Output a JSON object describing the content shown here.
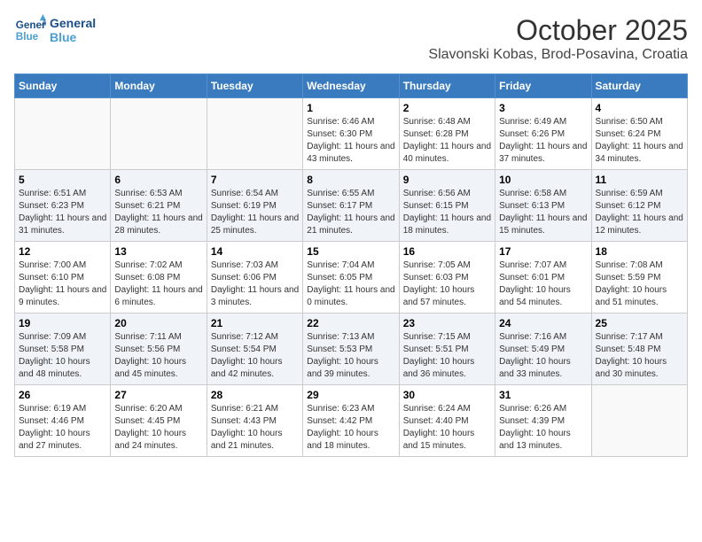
{
  "header": {
    "logo": {
      "line1": "General",
      "line2": "Blue"
    },
    "title": "October 2025",
    "subtitle": "Slavonski Kobas, Brod-Posavina, Croatia"
  },
  "days_of_week": [
    "Sunday",
    "Monday",
    "Tuesday",
    "Wednesday",
    "Thursday",
    "Friday",
    "Saturday"
  ],
  "weeks": [
    [
      {
        "day": "",
        "info": ""
      },
      {
        "day": "",
        "info": ""
      },
      {
        "day": "",
        "info": ""
      },
      {
        "day": "1",
        "info": "Sunrise: 6:46 AM\nSunset: 6:30 PM\nDaylight: 11 hours and 43 minutes."
      },
      {
        "day": "2",
        "info": "Sunrise: 6:48 AM\nSunset: 6:28 PM\nDaylight: 11 hours and 40 minutes."
      },
      {
        "day": "3",
        "info": "Sunrise: 6:49 AM\nSunset: 6:26 PM\nDaylight: 11 hours and 37 minutes."
      },
      {
        "day": "4",
        "info": "Sunrise: 6:50 AM\nSunset: 6:24 PM\nDaylight: 11 hours and 34 minutes."
      }
    ],
    [
      {
        "day": "5",
        "info": "Sunrise: 6:51 AM\nSunset: 6:23 PM\nDaylight: 11 hours and 31 minutes."
      },
      {
        "day": "6",
        "info": "Sunrise: 6:53 AM\nSunset: 6:21 PM\nDaylight: 11 hours and 28 minutes."
      },
      {
        "day": "7",
        "info": "Sunrise: 6:54 AM\nSunset: 6:19 PM\nDaylight: 11 hours and 25 minutes."
      },
      {
        "day": "8",
        "info": "Sunrise: 6:55 AM\nSunset: 6:17 PM\nDaylight: 11 hours and 21 minutes."
      },
      {
        "day": "9",
        "info": "Sunrise: 6:56 AM\nSunset: 6:15 PM\nDaylight: 11 hours and 18 minutes."
      },
      {
        "day": "10",
        "info": "Sunrise: 6:58 AM\nSunset: 6:13 PM\nDaylight: 11 hours and 15 minutes."
      },
      {
        "day": "11",
        "info": "Sunrise: 6:59 AM\nSunset: 6:12 PM\nDaylight: 11 hours and 12 minutes."
      }
    ],
    [
      {
        "day": "12",
        "info": "Sunrise: 7:00 AM\nSunset: 6:10 PM\nDaylight: 11 hours and 9 minutes."
      },
      {
        "day": "13",
        "info": "Sunrise: 7:02 AM\nSunset: 6:08 PM\nDaylight: 11 hours and 6 minutes."
      },
      {
        "day": "14",
        "info": "Sunrise: 7:03 AM\nSunset: 6:06 PM\nDaylight: 11 hours and 3 minutes."
      },
      {
        "day": "15",
        "info": "Sunrise: 7:04 AM\nSunset: 6:05 PM\nDaylight: 11 hours and 0 minutes."
      },
      {
        "day": "16",
        "info": "Sunrise: 7:05 AM\nSunset: 6:03 PM\nDaylight: 10 hours and 57 minutes."
      },
      {
        "day": "17",
        "info": "Sunrise: 7:07 AM\nSunset: 6:01 PM\nDaylight: 10 hours and 54 minutes."
      },
      {
        "day": "18",
        "info": "Sunrise: 7:08 AM\nSunset: 5:59 PM\nDaylight: 10 hours and 51 minutes."
      }
    ],
    [
      {
        "day": "19",
        "info": "Sunrise: 7:09 AM\nSunset: 5:58 PM\nDaylight: 10 hours and 48 minutes."
      },
      {
        "day": "20",
        "info": "Sunrise: 7:11 AM\nSunset: 5:56 PM\nDaylight: 10 hours and 45 minutes."
      },
      {
        "day": "21",
        "info": "Sunrise: 7:12 AM\nSunset: 5:54 PM\nDaylight: 10 hours and 42 minutes."
      },
      {
        "day": "22",
        "info": "Sunrise: 7:13 AM\nSunset: 5:53 PM\nDaylight: 10 hours and 39 minutes."
      },
      {
        "day": "23",
        "info": "Sunrise: 7:15 AM\nSunset: 5:51 PM\nDaylight: 10 hours and 36 minutes."
      },
      {
        "day": "24",
        "info": "Sunrise: 7:16 AM\nSunset: 5:49 PM\nDaylight: 10 hours and 33 minutes."
      },
      {
        "day": "25",
        "info": "Sunrise: 7:17 AM\nSunset: 5:48 PM\nDaylight: 10 hours and 30 minutes."
      }
    ],
    [
      {
        "day": "26",
        "info": "Sunrise: 6:19 AM\nSunset: 4:46 PM\nDaylight: 10 hours and 27 minutes."
      },
      {
        "day": "27",
        "info": "Sunrise: 6:20 AM\nSunset: 4:45 PM\nDaylight: 10 hours and 24 minutes."
      },
      {
        "day": "28",
        "info": "Sunrise: 6:21 AM\nSunset: 4:43 PM\nDaylight: 10 hours and 21 minutes."
      },
      {
        "day": "29",
        "info": "Sunrise: 6:23 AM\nSunset: 4:42 PM\nDaylight: 10 hours and 18 minutes."
      },
      {
        "day": "30",
        "info": "Sunrise: 6:24 AM\nSunset: 4:40 PM\nDaylight: 10 hours and 15 minutes."
      },
      {
        "day": "31",
        "info": "Sunrise: 6:26 AM\nSunset: 4:39 PM\nDaylight: 10 hours and 13 minutes."
      },
      {
        "day": "",
        "info": ""
      }
    ]
  ]
}
